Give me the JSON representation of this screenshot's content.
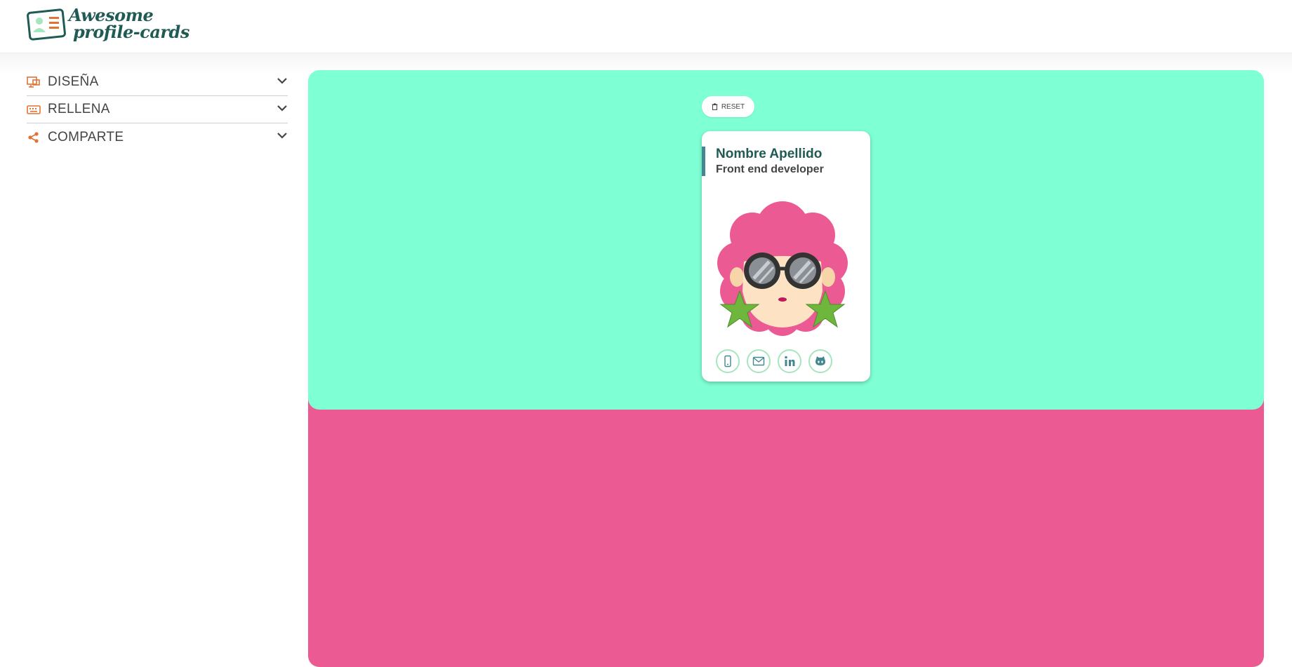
{
  "app": {
    "logo_line1": "Awesome",
    "logo_line2": "profile-cards"
  },
  "sidebar": {
    "items": [
      {
        "label": "DISEÑA",
        "icon": "palette-icon"
      },
      {
        "label": "RELLENA",
        "icon": "keyboard-icon"
      },
      {
        "label": "COMPARTE",
        "icon": "share-icon"
      }
    ]
  },
  "preview": {
    "reset_label": "RESET",
    "card": {
      "name": "Nombre Apellido",
      "job": "Front end developer",
      "socials": [
        "phone-icon",
        "mail-icon",
        "linkedin-icon",
        "github-icon"
      ]
    }
  },
  "colors": {
    "brand_dark": "#1f5a54",
    "accent_orange": "#e17334",
    "preview_top": "#7fffd4",
    "preview_bottom": "#ec5a93",
    "card_accent": "#438792"
  }
}
